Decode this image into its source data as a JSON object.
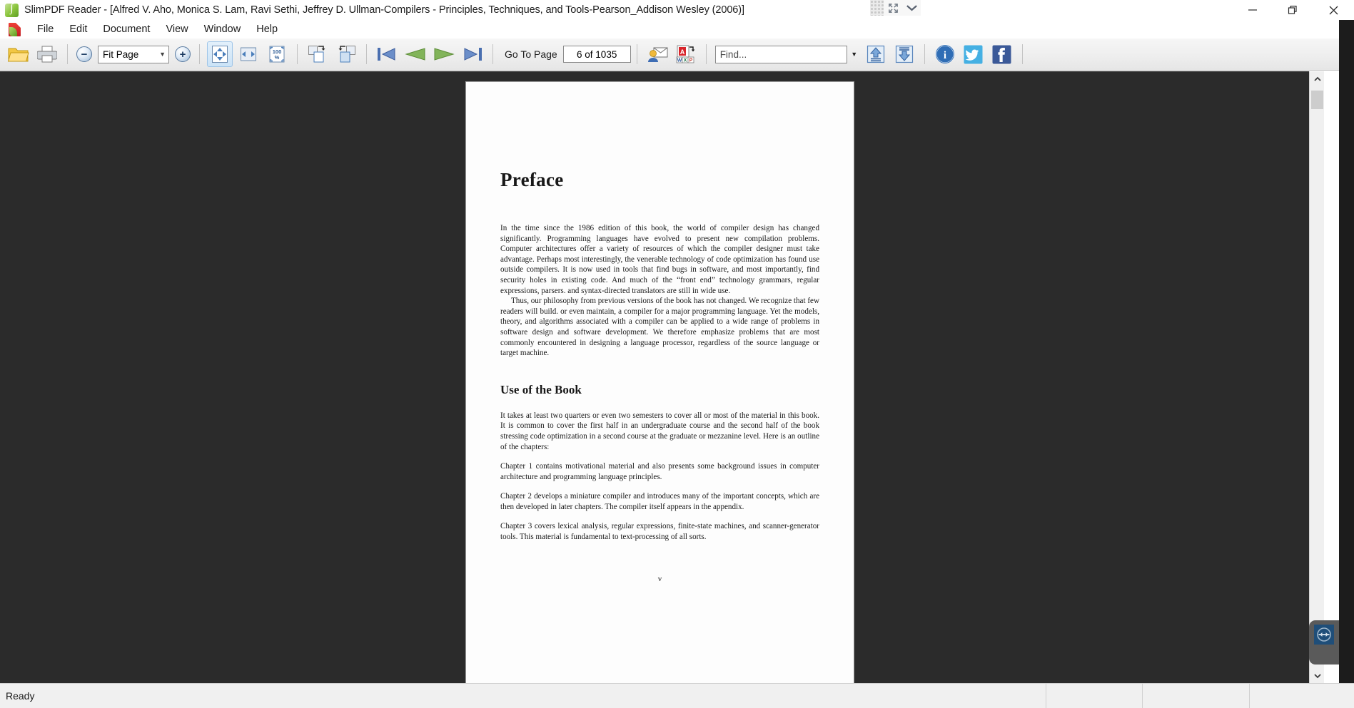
{
  "window": {
    "app_name": "SlimPDF Reader",
    "title": "SlimPDF Reader - [Alfred V. Aho, Monica S. Lam, Ravi Sethi, Jeffrey D. Ullman-Compilers - Principles, Techniques, and Tools-Pearson_Addison Wesley (2006)]",
    "app_icon": "slimpdf-logo-icon",
    "controls": {
      "minimize": "minimize-icon",
      "restore": "restore-icon",
      "close": "close-icon"
    },
    "mdi_controls": {
      "minimize": "mdi-minimize-icon",
      "restore": "mdi-restore-icon",
      "close": "mdi-close-icon"
    }
  },
  "float_toolbar": {
    "grip": "drag-grip-icon",
    "expand": "expand-arrows-icon",
    "chevron": "chevron-down-icon"
  },
  "menubar": {
    "doc_icon": "document-icon",
    "items": [
      {
        "label": "File"
      },
      {
        "label": "Edit"
      },
      {
        "label": "Document"
      },
      {
        "label": "View"
      },
      {
        "label": "Window"
      },
      {
        "label": "Help"
      }
    ]
  },
  "toolbar": {
    "open_label": "Open",
    "open_icon": "open-folder-icon",
    "print_label": "Print",
    "print_icon": "printer-icon",
    "zoom_out_icon": "zoom-out-icon",
    "zoom_out_glyph": "−",
    "zoom_in_icon": "zoom-in-icon",
    "zoom_in_glyph": "+",
    "zoom_value": "Fit Page",
    "zoom_options": [
      "Fit Page",
      "Fit Width",
      "100%"
    ],
    "fit_page_icon": "fit-page-icon",
    "fit_width_icon": "fit-width-icon",
    "actual_size_icon": "actual-size-icon",
    "actual_size_text": "100 %",
    "rotate_cw_icon": "rotate-clockwise-icon",
    "rotate_ccw_icon": "rotate-counterclockwise-icon",
    "first_page_icon": "first-page-icon",
    "prev_page_icon": "previous-page-icon",
    "next_page_icon": "next-page-icon",
    "last_page_icon": "last-page-icon",
    "goto_label": "Go To Page",
    "page_value": "6 of 1035",
    "email_icon": "email-document-icon",
    "convert_icon": "pdf-convert-icon",
    "convert_badges": [
      "W",
      "X",
      "P"
    ],
    "find_placeholder": "Find...",
    "find_value": "",
    "find_chevron_icon": "chevron-down-icon",
    "find_prev_icon": "find-previous-icon",
    "find_next_icon": "find-next-icon",
    "info_icon": "info-icon",
    "twitter_icon": "twitter-icon",
    "facebook_icon": "facebook-icon",
    "accent_blue": "#1f4e79",
    "highlight_blue": "#cbe3f7"
  },
  "document": {
    "page_label": "v",
    "heading": "Preface",
    "paragraphs": [
      "In the time since the 1986 edition of this book, the world of compiler design has changed significantly. Programming languages have evolved to present new compilation problems. Computer architectures offer a variety of resources of which the compiler designer must take advantage. Perhaps most interestingly, the venerable technology of code optimization has found use outside compilers. It is now used in tools that find bugs in software, and most importantly, find security holes in existing code. And much of the “front end” technology grammars, regular expressions, parsers. and syntax-directed translators    are still in wide use.",
      "Thus, our philosophy from previous versions of the book has not changed. We recognize that few readers will build. or even maintain, a compiler for a major programming language. Yet the models, theory, and algorithms associated with a compiler can be applied to a wide range of problems in software design and software development. We therefore emphasize problems that are most commonly encountered in designing a language processor, regardless of the source language or target machine."
    ],
    "section_heading": "Use of the Book",
    "section_paragraphs": [
      "It takes at least two quarters or even two semesters to cover all or most of the material in this book. It is common to cover the first half in an undergraduate course and the second half of the book    stressing code optimization    in a second course at the graduate or mezzanine level. Here is an outline of the chapters:",
      "Chapter 1 contains motivational material and also presents some background issues in computer architecture and programming language principles.",
      "Chapter 2 develops a miniature compiler and introduces many of the important concepts, which are then developed in later chapters. The compiler itself appears in the appendix.",
      "Chapter 3 covers lexical analysis, regular expressions, finite-state machines, and scanner-generator tools. This material is fundamental to text-processing of all sorts."
    ]
  },
  "scrollbar": {
    "up_icon": "scroll-up-icon",
    "down_icon": "scroll-down-icon",
    "thumb": "scroll-thumb"
  },
  "float_tab": {
    "icon": "resize-arrows-icon"
  },
  "statusbar": {
    "message": "Ready"
  }
}
